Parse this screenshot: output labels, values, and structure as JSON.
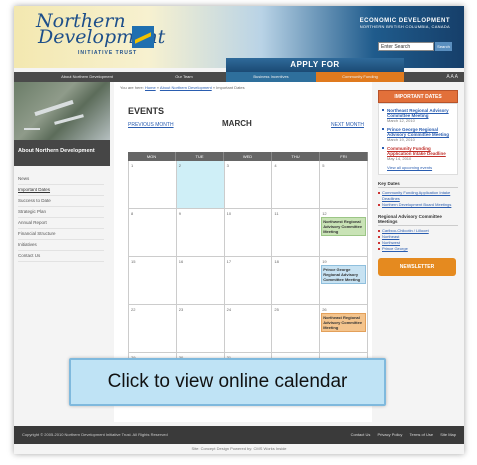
{
  "header": {
    "logo_line1": "Northern",
    "logo_line2": "Development",
    "logo_tagline": "INITIATIVE TRUST",
    "eco_title": "ECONOMIC DEVELOPMENT",
    "eco_subtitle": "NORTHERN BRITISH COLUMBIA, CANADA",
    "search_value": "Enter Search",
    "search_button": "Search",
    "apply_for": "APPLY FOR"
  },
  "nav": {
    "about": "About Northern Development",
    "trust": "Our Team",
    "business": "Business Incentives",
    "community": "Community Funding",
    "tools": "A A A"
  },
  "left": {
    "title": "About Northern Development",
    "items": [
      "News",
      "Important Dates",
      "Success to Date",
      "Strategic Plan",
      "Annual Report",
      "Financial Structure",
      "Initiatives",
      "Contact Us"
    ]
  },
  "main": {
    "breadcrumb_prefix": "You are here:",
    "breadcrumb_home": "Home",
    "breadcrumb_about": "About Northern Development",
    "breadcrumb_current": "Important Dates",
    "events_title": "EVENTS",
    "prev_month": "PREVIOUS MONTH",
    "month": "MARCH",
    "next_month": "NEXT MONTH",
    "weekdays": [
      "MON",
      "TUE",
      "WED",
      "THU",
      "FRI"
    ],
    "weeks": [
      [
        "1",
        "2",
        "3",
        "4",
        "5"
      ],
      [
        "8",
        "9",
        "10",
        "11",
        "12"
      ],
      [
        "15",
        "16",
        "17",
        "18",
        "19"
      ],
      [
        "22",
        "23",
        "24",
        "25",
        "26"
      ],
      [
        "29",
        "30",
        "31",
        "",
        ""
      ]
    ],
    "event_12": "Northwest Regional Advisory Committee Meeting",
    "event_19": "Prince George Regional Advisory Committee Meeting",
    "event_26": "Northeast Regional Advisory Committee Meeting"
  },
  "right": {
    "important_title": "IMPORTANT DATES",
    "items": [
      {
        "name": "Northeast Regional Advisory Committee Meeting",
        "date": "March 12, 2010"
      },
      {
        "name": "Prince George Regional Advisory Committee Meeting",
        "date": "March 19, 2010"
      },
      {
        "name": "Community Funding Application Intake Deadline",
        "date": "May 14, 2010"
      }
    ],
    "view_all": "View all upcoming events",
    "key_dates_title": "Key Dates",
    "key_dates_links": [
      "Community Funding Application Intake Deadlines",
      "Northern Development Board Meetings"
    ],
    "rac_title": "Regional Advisory Committee Meetings",
    "rac_links": [
      "Cariboo-Chilcotin / Lillooet",
      "Northeast",
      "Northwest",
      "Prince George"
    ],
    "newsletter": "NEWSLETTER"
  },
  "footer": {
    "copyright": "Copyright © 2005-2010 Northern Development Initiative Trust. All Rights Reserved",
    "links": [
      "Contact Us",
      "Privacy Policy",
      "Terms of Use",
      "Site Map"
    ],
    "credit": "Site: Concept Design   Powered by: CMS Works Inside"
  },
  "cta": {
    "label": "Click to view online calendar"
  }
}
